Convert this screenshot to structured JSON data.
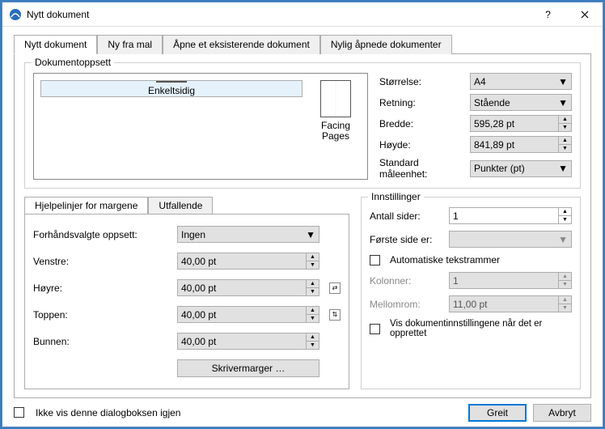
{
  "window": {
    "title": "Nytt dokument"
  },
  "tabs": {
    "new_doc": "Nytt dokument",
    "from_template": "Ny fra mal",
    "open_existing": "Åpne et eksisterende dokument",
    "recent": "Nylig åpnede dokumenter"
  },
  "layout": {
    "group_title": "Dokumentoppsett",
    "single": "Enkeltsidig",
    "facing": "Facing Pages",
    "size_label": "Størrelse:",
    "size_value": "A4",
    "orient_label": "Retning:",
    "orient_value": "Stående",
    "width_label": "Bredde:",
    "width_value": "595,28 pt",
    "height_label": "Høyde:",
    "height_value": "841,89 pt",
    "unit_label": "Standard måleenhet:",
    "unit_value": "Punkter (pt)"
  },
  "margins": {
    "tab_margins": "Hjelpelinjer for margene",
    "tab_bleed": "Utfallende",
    "preset_label": "Forhåndsvalgte oppsett:",
    "preset_value": "Ingen",
    "left_label": "Venstre:",
    "right_label": "Høyre:",
    "top_label": "Toppen:",
    "bottom_label": "Bunnen:",
    "value": "40,00 pt",
    "printer_btn": "Skrivermarger …"
  },
  "settings": {
    "group_title": "Innstillinger",
    "pages_label": "Antall sider:",
    "pages_value": "1",
    "first_label": "Første side er:",
    "first_value": "",
    "auto_frames": "Automatiske tekstrammer",
    "columns_label": "Kolonner:",
    "columns_value": "1",
    "gap_label": "Mellomrom:",
    "gap_value": "11,00 pt",
    "show_settings": "Vis dokumentinnstillingene når det er opprettet"
  },
  "footer": {
    "dont_show": "Ikke vis denne dialogboksen igjen",
    "ok": "Greit",
    "cancel": "Avbryt"
  }
}
